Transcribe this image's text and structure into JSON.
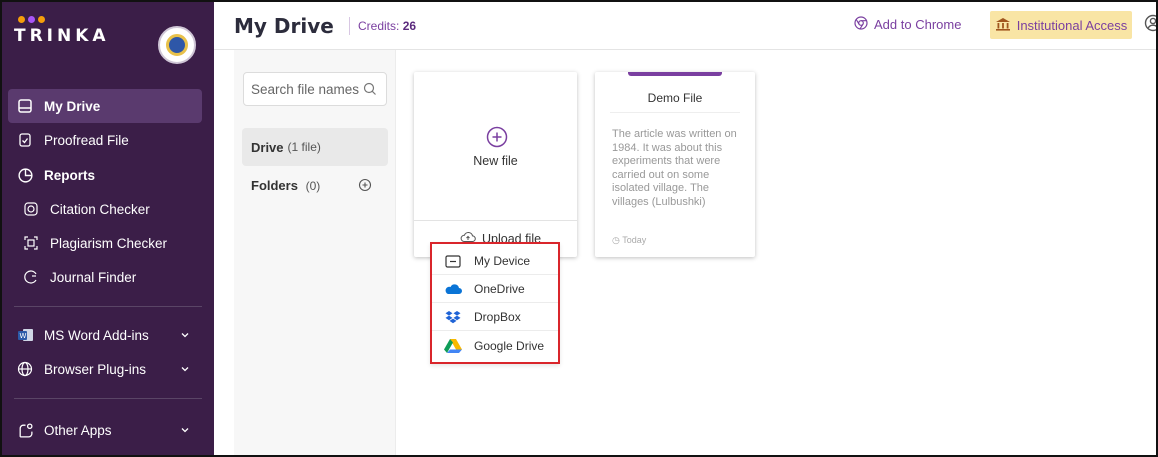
{
  "brand": {
    "name": "TRINKA",
    "dot_colors": [
      "#f59e0b",
      "#a855f7",
      "#f59e0b"
    ]
  },
  "sidebar": {
    "items": [
      {
        "label": "My Drive",
        "icon": "drive-icon",
        "active": true
      },
      {
        "label": "Proofread File",
        "icon": "document-check-icon"
      },
      {
        "label": "Reports",
        "icon": "reports-icon"
      },
      {
        "label": "Citation Checker",
        "icon": "citation-icon"
      },
      {
        "label": "Plagiarism Checker",
        "icon": "plagiarism-icon"
      },
      {
        "label": "Journal Finder",
        "icon": "journal-finder-icon"
      },
      {
        "label": "MS Word Add-ins",
        "icon": "ms-word-icon"
      },
      {
        "label": "Browser Plug-ins",
        "icon": "globe-icon"
      },
      {
        "label": "Other Apps",
        "icon": "apps-icon"
      }
    ]
  },
  "header": {
    "title": "My Drive",
    "credits_label": "Credits:",
    "credits_value": "26",
    "add_to_chrome": "Add to Chrome",
    "institutional_access": "Institutional Access"
  },
  "files_panel": {
    "search_placeholder": "Search file names",
    "drive_label": "Drive",
    "drive_count": "(1 file)",
    "folders_label": "Folders",
    "folders_count": "(0)"
  },
  "cards": {
    "new_file_label": "New file",
    "upload_label": "Upload file",
    "demo_title": "Demo File",
    "demo_body": "The article was written on 1984. It was about this experiments that were carried out on some isolated village. The villages (Lulbushki)",
    "demo_date": "Today"
  },
  "upload_menu": [
    {
      "label": "My Device",
      "icon": "device-icon"
    },
    {
      "label": "OneDrive",
      "icon": "onedrive-icon"
    },
    {
      "label": "DropBox",
      "icon": "dropbox-icon"
    },
    {
      "label": "Google Drive",
      "icon": "google-drive-icon"
    }
  ],
  "colors": {
    "sidebar_bg": "#3b1e48",
    "accent": "#7a3fa0",
    "highlight_border": "#d9252b",
    "institutional_bg": "#f9e5a5"
  }
}
